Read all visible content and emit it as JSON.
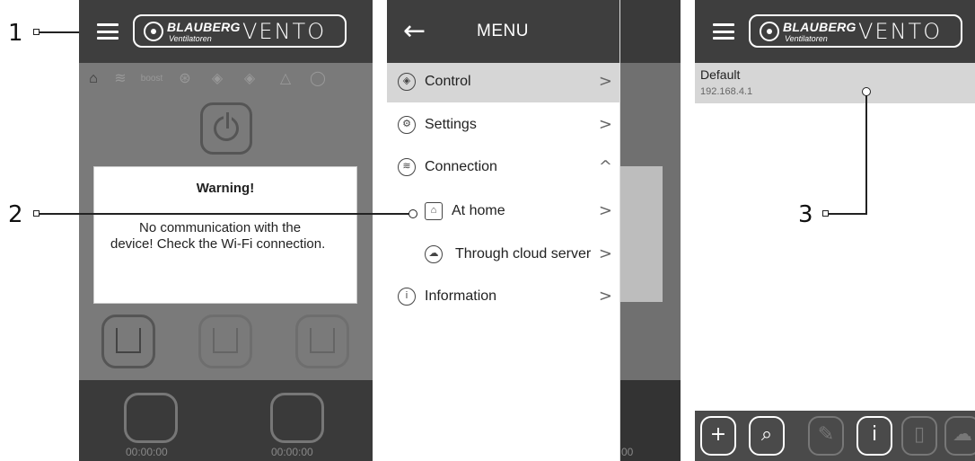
{
  "callouts": {
    "one": "1",
    "two": "2",
    "three": "3"
  },
  "logo": {
    "brand": "BLAUBERG",
    "sub": "Ventilatoren",
    "product": "VENTO"
  },
  "screen1": {
    "status_boost": "boost",
    "warning_title": "Warning!",
    "warning_message": "No communication with the device! Check the Wi-Fi connection.",
    "timer_left": "00:00:00",
    "timer_right": "00:00:00"
  },
  "menu": {
    "back": "←",
    "title": "MENU",
    "items": [
      {
        "label": "Control",
        "icon": "control-icon",
        "chevron": ">"
      },
      {
        "label": "Settings",
        "icon": "settings-icon",
        "chevron": ">"
      },
      {
        "label": "Connection",
        "icon": "wifi-icon",
        "chevron": "^"
      },
      {
        "label": "At home",
        "icon": "home-wifi-icon",
        "chevron": ">"
      },
      {
        "label": "Through cloud server",
        "icon": "cloud-icon",
        "chevron": ">"
      },
      {
        "label": "Information",
        "icon": "info-icon",
        "chevron": ">"
      }
    ],
    "behind_timer": "00"
  },
  "screen3": {
    "device_name": "Default",
    "device_ip": "192.168.4.1",
    "toolbar": [
      "add-icon",
      "search-icon",
      "edit-icon",
      "info-icon",
      "delete-icon",
      "cloud-icon"
    ]
  },
  "colors": {
    "appbar": "#3e3e3e",
    "overlay": "#7a7a7a",
    "selected": "#d6d6d6"
  }
}
